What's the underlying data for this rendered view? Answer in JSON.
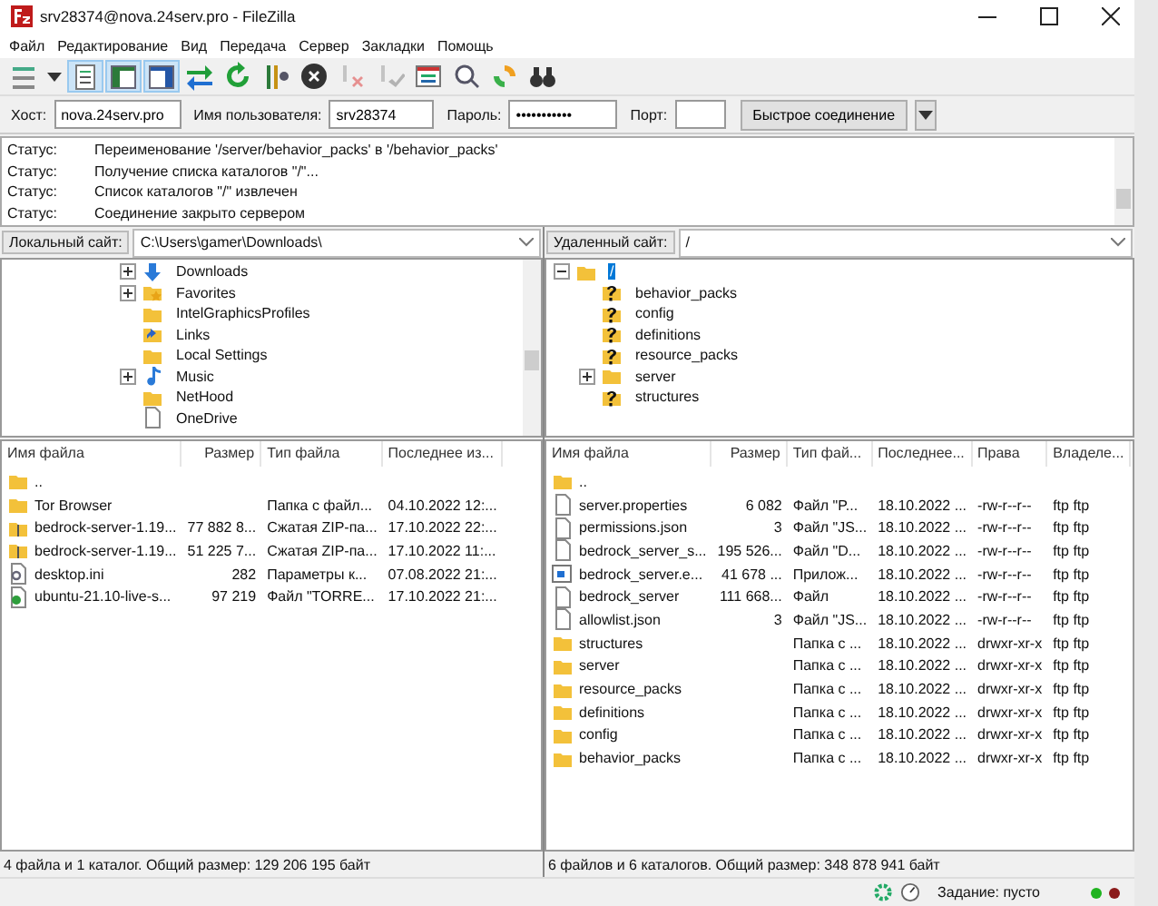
{
  "window": {
    "title": "srv28374@nova.24serv.pro - FileZilla"
  },
  "menu": [
    "Файл",
    "Редактирование",
    "Вид",
    "Передача",
    "Сервер",
    "Закладки",
    "Помощь"
  ],
  "toolbar": [
    {
      "kind": "site_manager",
      "pressed": false,
      "disabled": false
    },
    {
      "kind": "dropdown",
      "pressed": false,
      "disabled": false
    },
    {
      "kind": "message_log",
      "pressed": true,
      "disabled": false
    },
    {
      "kind": "local_tree",
      "pressed": true,
      "disabled": false
    },
    {
      "kind": "remote_tree",
      "pressed": true,
      "disabled": false
    },
    {
      "kind": "transfer_queue",
      "pressed": false,
      "disabled": false
    },
    {
      "kind": "refresh",
      "pressed": false,
      "disabled": false
    },
    {
      "kind": "process_queue",
      "pressed": false,
      "disabled": false
    },
    {
      "kind": "cancel",
      "pressed": false,
      "disabled": false
    },
    {
      "kind": "disconnect",
      "pressed": false,
      "disabled": true
    },
    {
      "kind": "reconnect",
      "pressed": false,
      "disabled": true
    },
    {
      "kind": "filter",
      "pressed": false,
      "disabled": false
    },
    {
      "kind": "compare",
      "pressed": false,
      "disabled": false
    },
    {
      "kind": "sync",
      "pressed": false,
      "disabled": false
    },
    {
      "kind": "search",
      "pressed": false,
      "disabled": false
    }
  ],
  "quickconnect": {
    "fields": [
      {
        "label": "Хост:",
        "value": "nova.24serv.pro"
      },
      {
        "label": "Имя пользователя:",
        "value": "srv28374"
      },
      {
        "label": "Пароль:",
        "value": "•••••••••••"
      },
      {
        "label": "Порт:"
      }
    ],
    "button": "Быстрое соединение"
  },
  "log": [
    {
      "label": "Статус:",
      "message": "Переименование '/server/behavior_packs' в '/behavior_packs'"
    },
    {
      "label": "Статус:",
      "message": "Получение списка каталогов \"/\"..."
    },
    {
      "label": "Статус:",
      "message": "Список каталогов \"/\" извлечен"
    },
    {
      "label": "Статус:",
      "message": "Соединение закрыто сервером"
    }
  ],
  "local": {
    "site_label": "Локальный сайт:",
    "path": "C:\\Users\\gamer\\Downloads\\",
    "tree": [
      {
        "name": "Downloads",
        "kind": "download",
        "expandable": true,
        "selected": false
      },
      {
        "name": "Favorites",
        "kind": "star",
        "expandable": true,
        "selected": false
      },
      {
        "name": "IntelGraphicsProfiles",
        "kind": "folder",
        "expandable": false,
        "selected": false
      },
      {
        "name": "Links",
        "kind": "link",
        "expandable": false,
        "selected": false
      },
      {
        "name": "Local Settings",
        "kind": "folder",
        "expandable": false,
        "selected": false
      },
      {
        "name": "Music",
        "kind": "music",
        "expandable": true,
        "selected": false
      },
      {
        "name": "NetHood",
        "kind": "folder",
        "expandable": false,
        "selected": false
      },
      {
        "name": "OneDrive",
        "kind": "file",
        "expandable": false,
        "selected": false
      }
    ],
    "columns": [
      "Имя файла",
      "Размер",
      "Тип файла",
      "Последнее из..."
    ],
    "rows": [
      {
        "kind": "folder",
        "name": ".."
      },
      {
        "kind": "folder",
        "name": "Tor Browser",
        "type": "Папка с файл...",
        "modified": "04.10.2022 12:..."
      },
      {
        "kind": "zip",
        "name": "bedrock-server-1.19...",
        "size": "77 882 8...",
        "type": "Сжатая ZIP-па...",
        "modified": "17.10.2022 22:..."
      },
      {
        "kind": "zip",
        "name": "bedrock-server-1.19...",
        "size": "51 225 7...",
        "type": "Сжатая ZIP-па...",
        "modified": "17.10.2022 11:..."
      },
      {
        "kind": "ini",
        "name": "desktop.ini",
        "size": "282",
        "type": "Параметры к...",
        "modified": "07.08.2022 21:..."
      },
      {
        "kind": "torrent",
        "name": "ubuntu-21.10-live-s...",
        "size": "97 219",
        "type": "Файл \"TORRE...",
        "modified": "17.10.2022 21:..."
      }
    ],
    "summary": "4 файла и 1 каталог. Общий размер: 129 206 195 байт"
  },
  "remote": {
    "site_label": "Удаленный сайт:",
    "path": "/",
    "tree": [
      {
        "name": "/",
        "kind": "folder",
        "expandable": true,
        "expanded": true,
        "selected": true,
        "children": [
          {
            "name": "behavior_packs",
            "kind": "unknown",
            "expandable": false,
            "selected": false
          },
          {
            "name": "config",
            "kind": "unknown",
            "expandable": false,
            "selected": false
          },
          {
            "name": "definitions",
            "kind": "unknown",
            "expandable": false,
            "selected": false
          },
          {
            "name": "resource_packs",
            "kind": "unknown",
            "expandable": false,
            "selected": false
          },
          {
            "name": "server",
            "kind": "folder",
            "expandable": true,
            "selected": false
          },
          {
            "name": "structures",
            "kind": "unknown",
            "expandable": false,
            "selected": false
          }
        ]
      }
    ],
    "columns": [
      "Имя файла",
      "Размер",
      "Тип фай...",
      "Последнее...",
      "Права",
      "Владеле..."
    ],
    "rows": [
      {
        "kind": "folder",
        "name": ".."
      },
      {
        "kind": "file",
        "name": "server.properties",
        "size": "6 082",
        "type": "Файл \"P...",
        "modified": "18.10.2022 ...",
        "rights": "-rw-r--r--",
        "owner": "ftp ftp"
      },
      {
        "kind": "file",
        "name": "permissions.json",
        "size": "3",
        "type": "Файл \"JS...",
        "modified": "18.10.2022 ...",
        "rights": "-rw-r--r--",
        "owner": "ftp ftp"
      },
      {
        "kind": "file",
        "name": "bedrock_server_s...",
        "size": "195 526...",
        "type": "Файл \"D...",
        "modified": "18.10.2022 ...",
        "rights": "-rw-r--r--",
        "owner": "ftp ftp"
      },
      {
        "kind": "exe",
        "name": "bedrock_server.e...",
        "size": "41 678 ...",
        "type": "Прилож...",
        "modified": "18.10.2022 ...",
        "rights": "-rw-r--r--",
        "owner": "ftp ftp"
      },
      {
        "kind": "file",
        "name": "bedrock_server",
        "size": "111 668...",
        "type": "Файл",
        "modified": "18.10.2022 ...",
        "rights": "-rw-r--r--",
        "owner": "ftp ftp"
      },
      {
        "kind": "file",
        "name": "allowlist.json",
        "size": "3",
        "type": "Файл \"JS...",
        "modified": "18.10.2022 ...",
        "rights": "-rw-r--r--",
        "owner": "ftp ftp"
      },
      {
        "kind": "folder",
        "name": "structures",
        "type": "Папка с ...",
        "modified": "18.10.2022 ...",
        "rights": "drwxr-xr-x",
        "owner": "ftp ftp"
      },
      {
        "kind": "folder",
        "name": "server",
        "type": "Папка с ...",
        "modified": "18.10.2022 ...",
        "rights": "drwxr-xr-x",
        "owner": "ftp ftp"
      },
      {
        "kind": "folder",
        "name": "resource_packs",
        "type": "Папка с ...",
        "modified": "18.10.2022 ...",
        "rights": "drwxr-xr-x",
        "owner": "ftp ftp"
      },
      {
        "kind": "folder",
        "name": "definitions",
        "type": "Папка с ...",
        "modified": "18.10.2022 ...",
        "rights": "drwxr-xr-x",
        "owner": "ftp ftp"
      },
      {
        "kind": "folder",
        "name": "config",
        "type": "Папка с ...",
        "modified": "18.10.2022 ...",
        "rights": "drwxr-xr-x",
        "owner": "ftp ftp"
      },
      {
        "kind": "folder",
        "name": "behavior_packs",
        "type": "Папка с ...",
        "modified": "18.10.2022 ...",
        "rights": "drwxr-xr-x",
        "owner": "ftp ftp"
      }
    ],
    "summary": "6 файлов и 6 каталогов. Общий размер: 348 878 941 байт"
  },
  "status_bar": {
    "queue": "Задание: пусто",
    "lights": [
      {
        "color": "#1fb31f"
      },
      {
        "color": "#8b1a1a"
      }
    ]
  }
}
